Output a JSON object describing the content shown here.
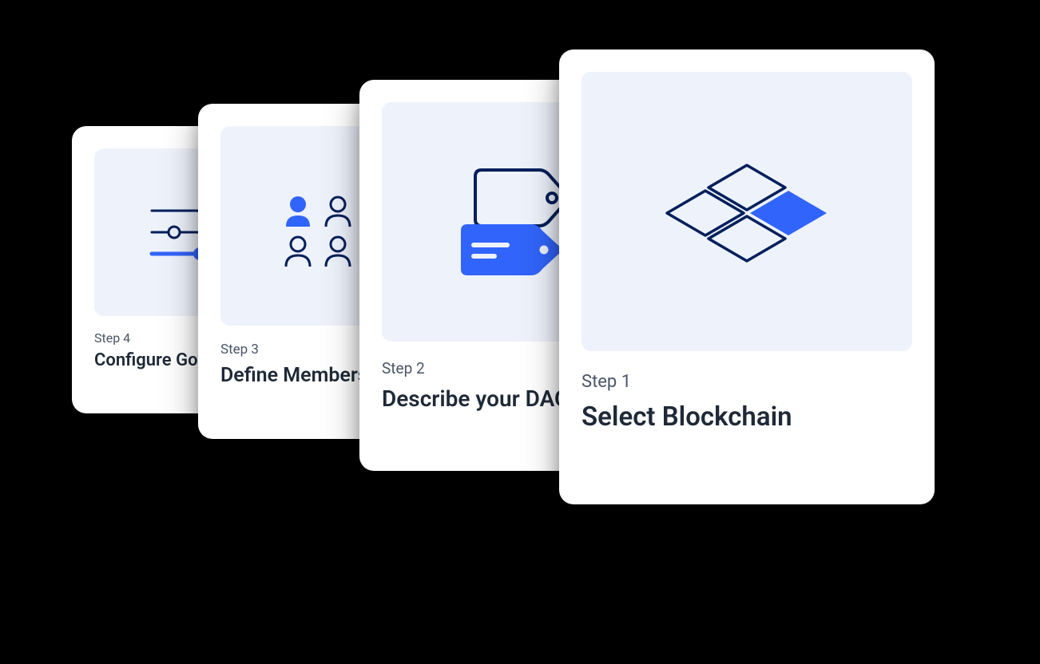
{
  "steps": [
    {
      "step_label": "Step 1",
      "title": "Select Blockchain",
      "icon": "blockchain-tiles"
    },
    {
      "step_label": "Step 2",
      "title": "Describe your DAO",
      "icon": "tags"
    },
    {
      "step_label": "Step 3",
      "title": "Define Membership",
      "icon": "members"
    },
    {
      "step_label": "Step 4",
      "title": "Configure Governance",
      "icon": "sliders"
    }
  ],
  "colors": {
    "accent": "#3164fa",
    "dark": "#001f5c",
    "card_bg": "#ffffff",
    "icon_bg": "#eef2fb",
    "text_muted": "#4a5568",
    "text_heading": "#1f2937"
  }
}
